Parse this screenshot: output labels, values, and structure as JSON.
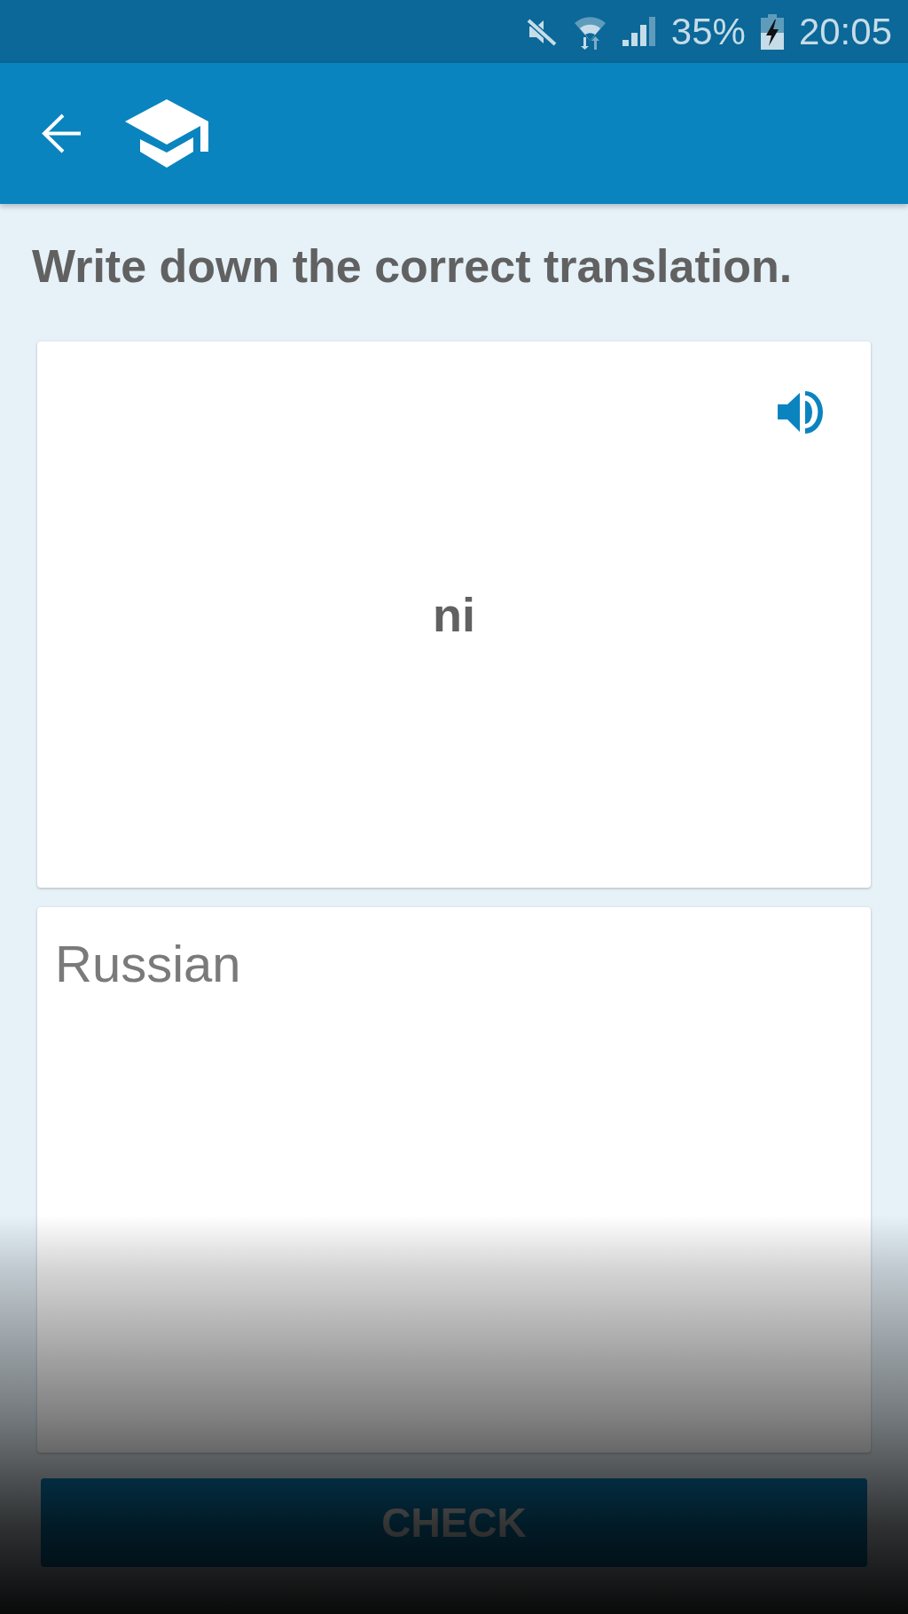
{
  "status_bar": {
    "battery_percent": "35%",
    "time": "20:05"
  },
  "instruction": "Write down the correct translation.",
  "prompt_card": {
    "word": "ni"
  },
  "answer_field": {
    "placeholder": "Russian"
  },
  "check_button": {
    "label": "CHECK"
  }
}
